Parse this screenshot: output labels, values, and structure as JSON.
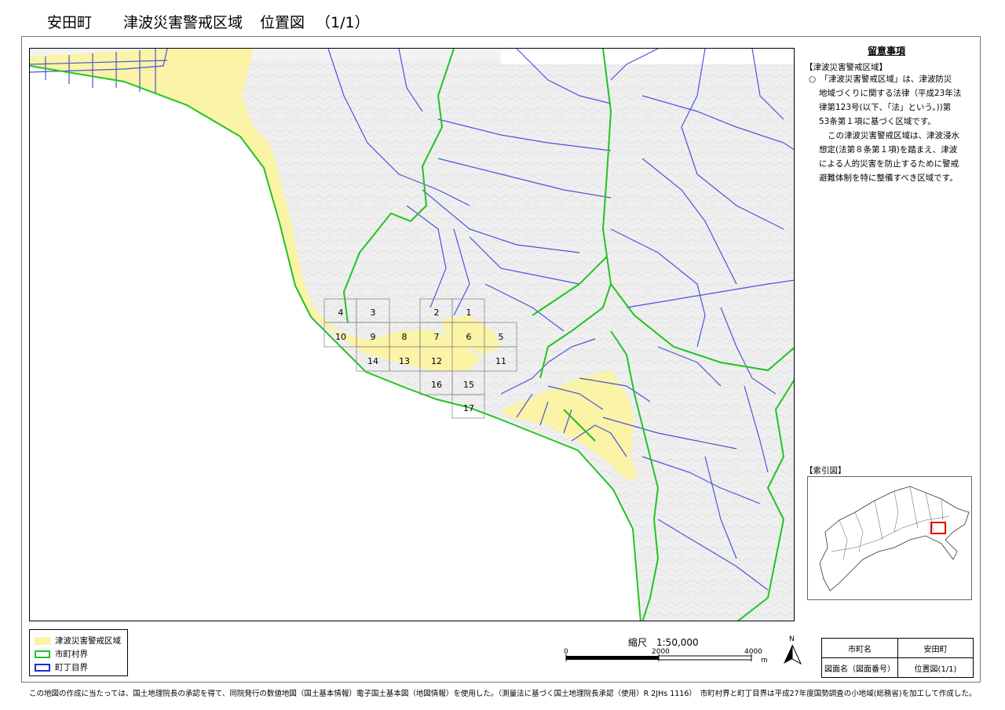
{
  "header": {
    "town": "安田町",
    "subject": "津波災害警戒区域",
    "doc": "位置図",
    "page": "（1/1）"
  },
  "notes": {
    "title": "留意事項",
    "heading": "【津波災害警戒区域】",
    "lines": [
      "○　「津波災害警戒区域」は、津波防災",
      "地域づくりに関する法律（平成23年法",
      "律第123号(以下、「法」という。))第",
      "53条第１項に基づく区域です。",
      "この津波災害警戒区域は、津波浸水",
      "想定(法第８条第１項)を踏まえ、津波",
      "による人的災害を防止するために警戒",
      "避難体制を特に整備すべき区域です。"
    ]
  },
  "index_map": {
    "heading": "【索引図】"
  },
  "grid_tiles": [
    "1",
    "2",
    "3",
    "4",
    "5",
    "6",
    "7",
    "8",
    "9",
    "10",
    "11",
    "12",
    "13",
    "14",
    "15",
    "16",
    "17"
  ],
  "legend": {
    "items": [
      {
        "label": "津波災害警戒区域",
        "color": "#fbf3a6"
      },
      {
        "label": "市町村界",
        "color": "#22c322"
      },
      {
        "label": "町丁目界",
        "color": "#1a2fd0"
      }
    ]
  },
  "scale": {
    "label": "縮尺　1:50,000",
    "ticks": [
      "0",
      "2000",
      "4000"
    ],
    "unit": "m"
  },
  "north_label": "N",
  "info_table": [
    [
      "市町名",
      "安田町"
    ],
    [
      "図面名（図面番号）",
      "位置図(1/1)"
    ]
  ],
  "footer": "この地図の作成に当たっては、国土地理院長の承認を得て、同院発行の数値地図（国土基本情報）電子国土基本図（地図情報）を使用した。（測量法に基づく国土地理院長承認（使用）R 2JHs 1116）　市町村界と町丁目界は平成27年度国勢調査の小地域(総務省)を加工して作成した。",
  "colors": {
    "hazard_zone": "#fbf3a6",
    "municipal_boundary": "#22c322",
    "district_boundary": "#4a55d8",
    "index_highlight": "#e00000"
  }
}
